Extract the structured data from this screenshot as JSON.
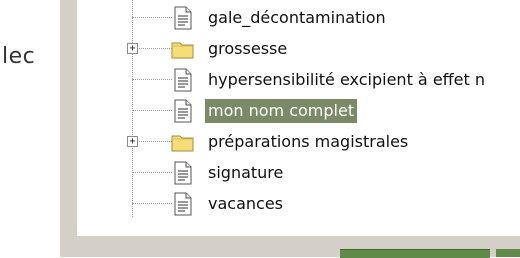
{
  "left_panel": {
    "label": "lec"
  },
  "tree": {
    "items": [
      {
        "label": "gale_décontamination",
        "icon": "document-icon",
        "expandable": false,
        "selected": false
      },
      {
        "label": "grossesse",
        "icon": "folder-icon",
        "expandable": true,
        "selected": false
      },
      {
        "label": "hypersensibilité excipient à effet n",
        "icon": "document-icon",
        "expandable": false,
        "selected": false
      },
      {
        "label": "mon nom complet",
        "icon": "document-icon",
        "expandable": false,
        "selected": true
      },
      {
        "label": "préparations magistrales",
        "icon": "folder-icon",
        "expandable": true,
        "selected": false
      },
      {
        "label": "signature",
        "icon": "document-icon",
        "expandable": false,
        "selected": false
      },
      {
        "label": "vacances",
        "icon": "document-icon",
        "expandable": false,
        "selected": false
      }
    ],
    "expander_symbol": "+"
  },
  "colors": {
    "selection": "#7a8a66",
    "folder": "#f5dd7a",
    "panel_gray": "#d4d0c8",
    "button_green": "#5f8a4a"
  }
}
